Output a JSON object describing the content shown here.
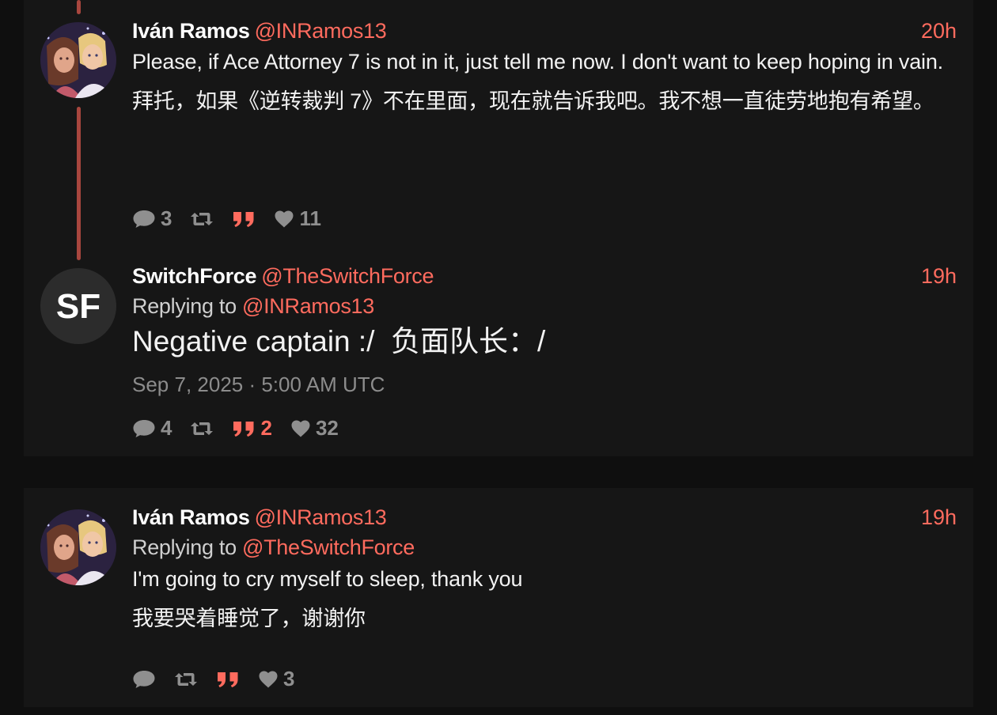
{
  "theme": {
    "accent": "#ff6b5e",
    "card_bg": "#161616",
    "page_bg": "#0f0f0f",
    "thread_line": "#a8463e",
    "stat_color": "#8f8f8f"
  },
  "tweets": [
    {
      "fullname": "Iván Ramos",
      "username": "@INRamos13",
      "time": "20h",
      "avatar": "avatar-ivan",
      "content": [
        "Please, if Ace Attorney 7 is not in it, just tell me now. I don't want to keep hoping in vain.",
        "拜托，如果《逆转裁判 7》不在里面，现在就告诉我吧。我不想一直徒劳地抱有希望。"
      ],
      "stats": {
        "replies": "3",
        "retweets": "",
        "quotes": "",
        "likes": "11"
      }
    },
    {
      "fullname": "SwitchForce",
      "username": "@TheSwitchForce",
      "time": "19h",
      "avatar": "avatar-switchforce",
      "avatar_text": "SF",
      "replying_prefix": "Replying to",
      "replying_to": "@INRamos13",
      "content": [
        "Negative captain :/  负面队长：/"
      ],
      "published": "Sep 7, 2025 · 5:00 AM UTC",
      "stats": {
        "replies": "4",
        "retweets": "",
        "quotes": "2",
        "likes": "32"
      }
    },
    {
      "fullname": "Iván Ramos",
      "username": "@INRamos13",
      "time": "19h",
      "avatar": "avatar-ivan",
      "replying_prefix": "Replying to",
      "replying_to": "@TheSwitchForce",
      "content": [
        "I'm going to cry myself to sleep, thank you",
        "我要哭着睡觉了，谢谢你"
      ],
      "stats": {
        "replies": "",
        "retweets": "",
        "quotes": "",
        "likes": "3"
      }
    }
  ]
}
